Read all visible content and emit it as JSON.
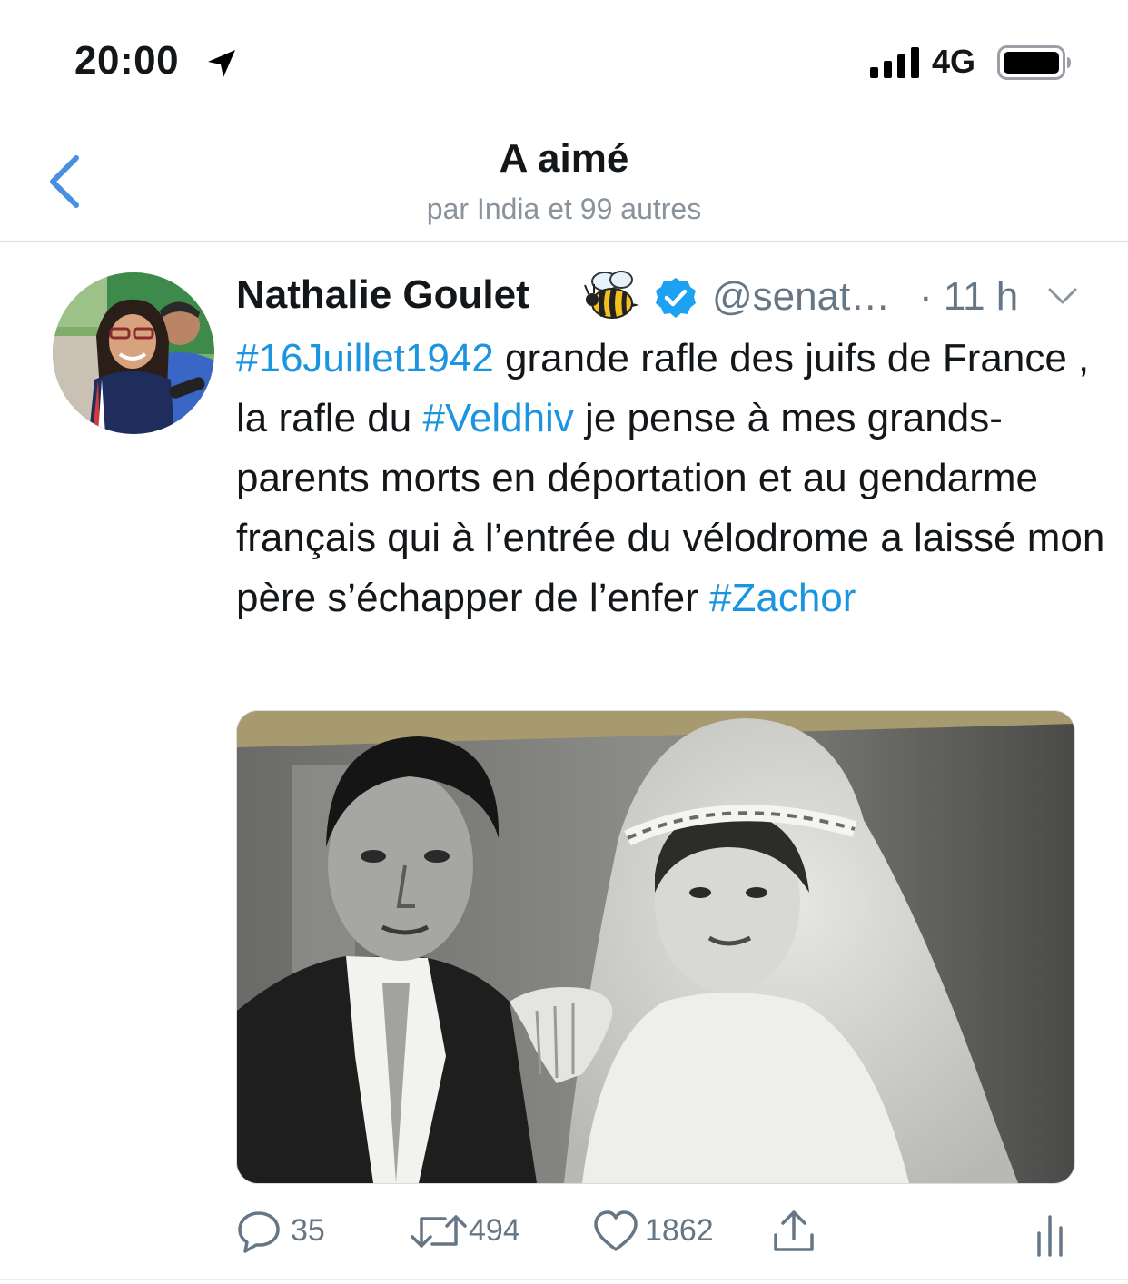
{
  "status_bar": {
    "time": "20:00",
    "network": "4G"
  },
  "header": {
    "title": "A aimé",
    "subtitle": "par India et 99 autres"
  },
  "tweet": {
    "author_name": "Nathalie Goulet",
    "author_emoji": "bee",
    "handle": "@senat…",
    "time": "· 11 h",
    "text": {
      "h1": "#16Juillet1942",
      "t1": " grande rafle des juifs de France , la rafle du ",
      "h2": "#Veldhiv",
      "t2": " je pense à mes grands-parents morts en déportation et au gendarme français qui à l’entrée du vélodrome a laissé mon père s’échapper de l’enfer ",
      "h3": "#Zachor"
    },
    "actions": {
      "replies": "35",
      "retweets": "494",
      "likes": "1862"
    }
  },
  "colors": {
    "accent": "#1b95e0",
    "secondary_text": "#657786",
    "nav_back": "#4a90e2"
  },
  "icons": [
    "location-arrow-icon",
    "signal-icon",
    "battery-icon",
    "back-chevron-icon",
    "bee-icon",
    "verified-icon",
    "chevron-down-icon",
    "reply-icon",
    "retweet-icon",
    "like-icon",
    "share-icon",
    "analytics-icon"
  ]
}
